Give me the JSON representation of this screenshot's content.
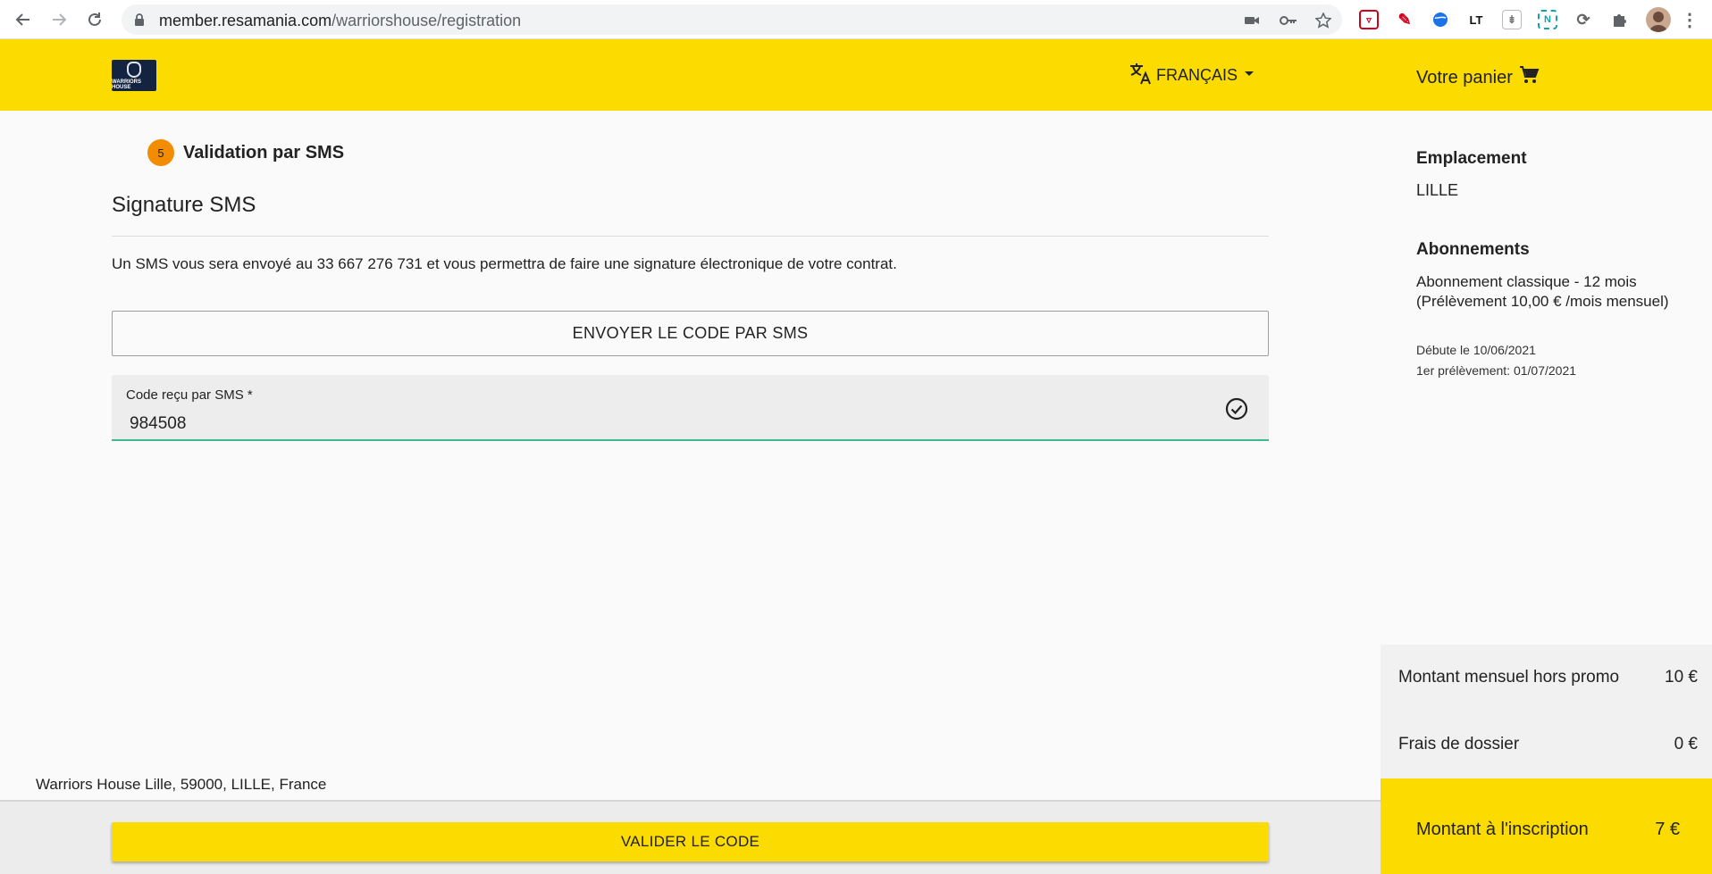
{
  "browser": {
    "url_host": "member.resamania.com",
    "url_path": "/warriorshouse/registration",
    "extensions": [
      "pocket-icon",
      "pen-icon",
      "globe-icon",
      "lt-icon",
      "bookmark-icon",
      "notion-icon",
      "sync-icon",
      "puzzle-icon",
      "profile-avatar"
    ]
  },
  "header": {
    "logo_text": "WARRIORS HOUSE",
    "language": "FRANÇAIS",
    "cart_label": "Votre panier"
  },
  "step": {
    "number": "5",
    "label": "Validation par SMS"
  },
  "main": {
    "title": "Signature SMS",
    "info": "Un SMS vous sera envoyé au 33 667 276 731 et vous permettra de faire une signature électronique de votre contrat.",
    "send_button": "ENVOYER LE CODE PAR SMS",
    "code_field": {
      "label": "Code reçu par SMS *",
      "value": "984508"
    }
  },
  "sidebar": {
    "location_heading": "Emplacement",
    "location_value": "LILLE",
    "subscriptions_heading": "Abonnements",
    "subscription_desc": "Abonnement classique - 12 mois (Prélèvement 10,00 € /mois mensuel)",
    "start_date": "Débute le 10/06/2021",
    "first_payment": "1er prélèvement: 01/07/2021"
  },
  "pricing": {
    "monthly_label": "Montant mensuel hors promo",
    "monthly_value": "10 €",
    "fees_label": "Frais de dossier",
    "fees_value": "0 €",
    "total_label": "Montant à l'inscription",
    "total_value": "7 €"
  },
  "footer": {
    "address": "Warriors House Lille, 59000, LILLE, France",
    "validate_button": "VALIDER LE CODE"
  },
  "colors": {
    "brand_yellow": "#fbdb00",
    "step_orange": "#f28c00",
    "field_underline": "#3cb98f"
  }
}
